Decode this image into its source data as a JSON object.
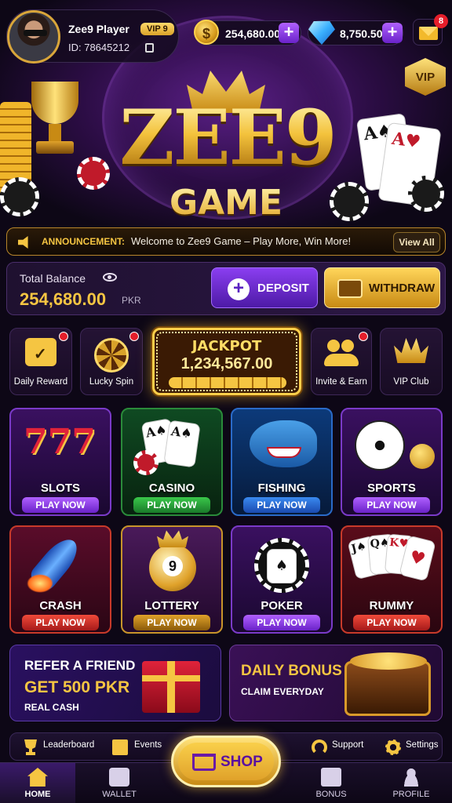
{
  "user": {
    "name": "Zee9 Player",
    "vip": "VIP 9",
    "id": "ID: 78645212"
  },
  "currency": {
    "coins": "254,680.00",
    "gems": "8,750.50",
    "mail_count": "8"
  },
  "vip_emblem": "VIP",
  "logo": {
    "main": "ZEE9",
    "sub": "GAME"
  },
  "announcement": {
    "label": "ANNOUNCEMENT:",
    "text": "Welcome to Zee9 Game – Play More, Win More!",
    "button": "View All"
  },
  "balance": {
    "label": "Total Balance",
    "value": "254,680.00",
    "currency": "PKR",
    "deposit": "DEPOSIT",
    "withdraw": "WITHDRAW"
  },
  "quick": {
    "daily": "Daily Reward",
    "spin": "Lucky Spin",
    "invite": "Invite & Earn",
    "vip": "VIP Club",
    "jackpot_label": "JACKPOT",
    "jackpot_value": "1,234,567.00"
  },
  "games": [
    {
      "name": "SLOTS",
      "play": "PLAY NOW"
    },
    {
      "name": "CASINO",
      "play": "PLAY NOW"
    },
    {
      "name": "FISHING",
      "play": "PLAY NOW"
    },
    {
      "name": "SPORTS",
      "play": "PLAY NOW"
    },
    {
      "name": "CRASH",
      "play": "PLAY NOW"
    },
    {
      "name": "LOTTERY",
      "play": "PLAY NOW"
    },
    {
      "name": "POKER",
      "play": "PLAY NOW"
    },
    {
      "name": "RUMMY",
      "play": "PLAY NOW"
    }
  ],
  "lottery_ball": "9",
  "slot_number": "777",
  "refer": {
    "line1": "REFER A FRIEND",
    "line2": "GET 500 PKR",
    "line3": "REAL CASH"
  },
  "bonus": {
    "line1": "DAILY BONUS",
    "line2": "CLAIM EVERYDAY"
  },
  "quickbar": {
    "leaderboard": "Leaderboard",
    "events": "Events",
    "support": "Support",
    "settings": "Settings"
  },
  "shop": "SHOP",
  "tabs": {
    "home": "HOME",
    "wallet": "WALLET",
    "bonus": "BONUS",
    "profile": "PROFILE"
  },
  "colors": {
    "gold": "#f5c542",
    "purple": "#6a22c8",
    "bg": "#0d0716"
  }
}
